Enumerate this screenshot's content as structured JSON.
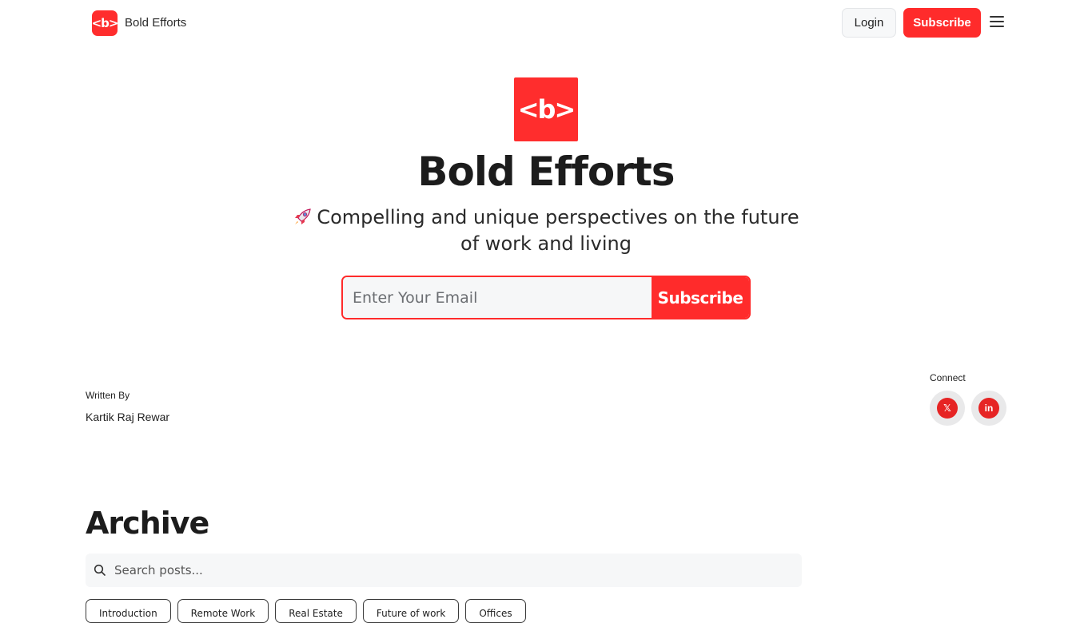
{
  "header": {
    "brand_logo": "<b>",
    "brand_name": "Bold Efforts",
    "login_label": "Login",
    "subscribe_label": "Subscribe",
    "menu_icon": "hamburger-icon"
  },
  "hero": {
    "logo_text": "<b>",
    "title": "Bold Efforts",
    "tagline": "Compelling and unique perspectives on the future of work and living",
    "tagline_icon": "rocket-icon",
    "email_placeholder": "Enter Your Email",
    "subscribe_label": "Subscribe"
  },
  "author": {
    "label": "Written By",
    "name": "Kartik Raj Rewar"
  },
  "connect": {
    "label": "Connect",
    "links": [
      {
        "icon": "x-icon",
        "glyph": "𝕏"
      },
      {
        "icon": "linkedin-icon",
        "glyph": "in"
      }
    ]
  },
  "archive": {
    "title": "Archive",
    "search_placeholder": "Search posts...",
    "tags": [
      "Introduction",
      "Remote Work",
      "Real Estate",
      "Future of work",
      "Offices"
    ]
  },
  "colors": {
    "accent": "#ff2b2b",
    "text": "#1c1c1c",
    "input_bg": "#f6f7f8"
  }
}
